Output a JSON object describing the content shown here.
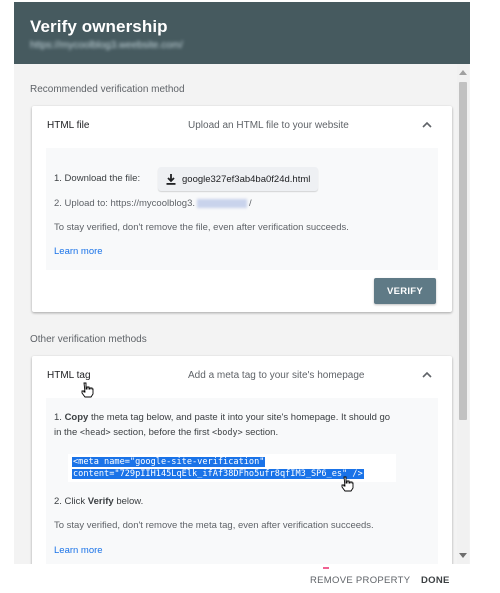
{
  "header": {
    "title": "Verify ownership",
    "url": "https://mycoolblog3.weebsite.com/"
  },
  "recommended": {
    "section_label": "Recommended verification method",
    "card_title": "HTML file",
    "card_desc": "Upload an HTML file to your website",
    "step1_label": "1. Download the file:",
    "download_filename": "google327ef3ab4ba0f24d.html",
    "step2_prefix": "2. Upload to: https://mycoolblog3.",
    "step2_suffix": "/",
    "note": "To stay verified, don't remove the file, even after verification succeeds.",
    "learn_more": "Learn more",
    "verify_label": "VERIFY"
  },
  "other": {
    "section_label": "Other verification methods",
    "card_title": "HTML tag",
    "card_desc": "Add a meta tag to your site's homepage",
    "step1_copy": "Copy",
    "step1_rest": " the meta tag below, and paste it into your site's homepage. It should go",
    "step1_line2_in": "in the ",
    "step1_head": "<head>",
    "step1_mid": " section, before the first ",
    "step1_body": "<body>",
    "step1_end": " section.",
    "code_line1": "<meta name=\"google-site-verification\"",
    "code_line2": "content=\"729pIIH145LqElk_ifAf38DFho5ufr8qfIM3_SP6_es\" />",
    "step2_prefix": "2. Click ",
    "step2_bold": "Verify",
    "step2_suffix": " below.",
    "note": "To stay verified, don't remove the meta tag, even after verification succeeds.",
    "learn_more": "Learn more"
  },
  "footer": {
    "remove_label": "REMOVE PROPERTY",
    "done_label": "DONE"
  },
  "colors": {
    "header_bg": "#465a5f",
    "verify_bg": "#5f7a86",
    "link": "#1a73e8",
    "highlight": "#1a73e8"
  }
}
